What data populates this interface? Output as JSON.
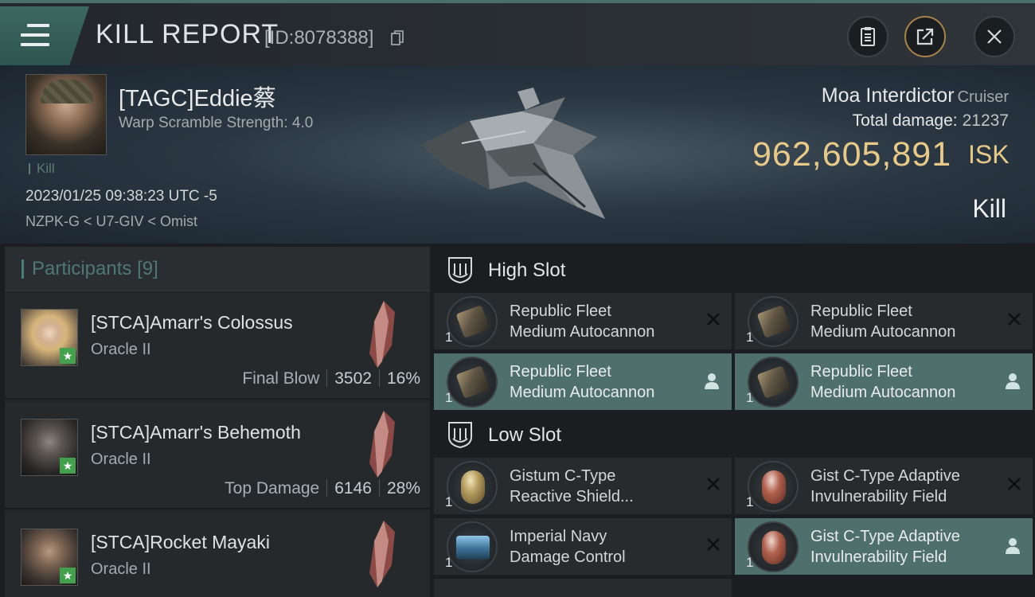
{
  "header": {
    "title": "KILL REPORT",
    "report_id": "[ID:8078388]"
  },
  "victim": {
    "pilot_name": "[TAGC]Eddie蔡",
    "warp_scramble": "Warp Scramble Strength: 4.0",
    "kill_tag": "Kill",
    "datetime": "2023/01/25 09:38:23 UTC -5",
    "location": "NZPK-G < U7-GIV < Omist",
    "ship_name": "Moa Interdictor",
    "ship_class": "Cruiser",
    "total_damage_label": "Total damage:",
    "total_damage": "21237",
    "isk_value": "962,605,891",
    "isk_unit": "ISK",
    "result": "Kill"
  },
  "participants": {
    "title": "Participants",
    "count": "[9]",
    "list": [
      {
        "name": "[STCA]Amarr's Colossus",
        "ship": "Oracle II",
        "role": "Final Blow",
        "damage": "3502",
        "percent": "16%"
      },
      {
        "name": "[STCA]Amarr's Behemoth",
        "ship": "Oracle II",
        "role": "Top Damage",
        "damage": "6146",
        "percent": "28%"
      },
      {
        "name": "[STCA]Rocket Mayaki",
        "ship": "Oracle II",
        "role": "",
        "damage": "",
        "percent": ""
      }
    ]
  },
  "slots": {
    "high": {
      "label": "High Slot",
      "modules": [
        {
          "name_line1": "Republic Fleet",
          "name_line2": "Medium Autocannon",
          "qty": "1",
          "status": "destroyed"
        },
        {
          "name_line1": "Republic Fleet",
          "name_line2": "Medium Autocannon",
          "qty": "1",
          "status": "destroyed"
        },
        {
          "name_line1": "Republic Fleet",
          "name_line2": "Medium Autocannon",
          "qty": "1",
          "status": "dropped"
        },
        {
          "name_line1": "Republic Fleet",
          "name_line2": "Medium Autocannon",
          "qty": "1",
          "status": "dropped"
        }
      ]
    },
    "low": {
      "label": "Low Slot",
      "modules": [
        {
          "name_line1": "Gistum C-Type",
          "name_line2": "Reactive Shield...",
          "qty": "1",
          "status": "destroyed"
        },
        {
          "name_line1": "Gist C-Type Adaptive",
          "name_line2": "Invulnerability Field",
          "qty": "1",
          "status": "destroyed"
        },
        {
          "name_line1": "Imperial Navy",
          "name_line2": "Damage Control",
          "qty": "1",
          "status": "destroyed"
        },
        {
          "name_line1": "Gist C-Type Adaptive",
          "name_line2": "Invulnerability Field",
          "qty": "1",
          "status": "dropped"
        }
      ]
    }
  },
  "colors": {
    "accent_teal": "#4e6f6c",
    "isk_gold": "#e7c98a",
    "star_green": "#43a14e"
  },
  "icons": {
    "menu": "hamburger-icon",
    "copy": "copy-icon",
    "clipboard": "clipboard-icon",
    "share": "share-icon",
    "close": "close-icon",
    "slot": "slot-shield-icon",
    "destroyed": "x-icon",
    "dropped": "user-icon"
  }
}
